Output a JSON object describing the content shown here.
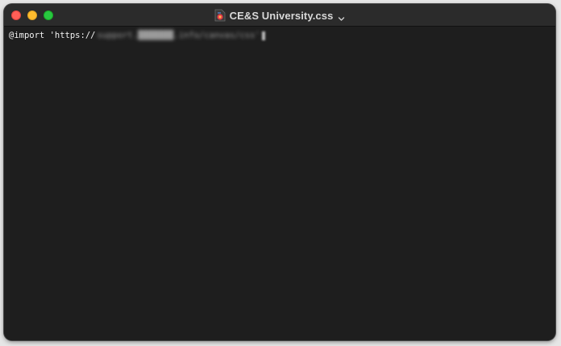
{
  "window": {
    "title": "CE&S University.css",
    "icon": "css-document-icon",
    "colors": {
      "close": "#ff5f57",
      "minimize": "#febc2e",
      "zoom": "#28c840",
      "editor_background": "#1e1e1e",
      "text": "#f2f2f2"
    }
  },
  "editor": {
    "line1": {
      "prefix": "@import 'https://",
      "redacted_url": "support.███████.info/canvas/css'"
    }
  }
}
